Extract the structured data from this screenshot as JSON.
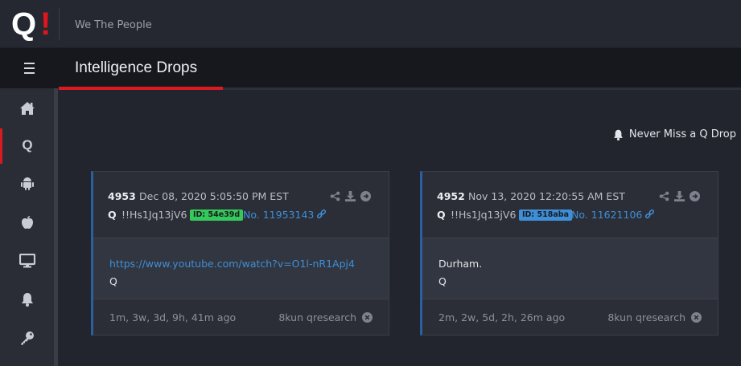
{
  "header": {
    "logo_letter": "Q",
    "logo_mark": "!",
    "tagline": "We The People"
  },
  "titlebar": {
    "menu_icon": "hamburger-icon",
    "title": "Intelligence Drops"
  },
  "sidebar": {
    "items": [
      {
        "name": "home",
        "icon": "home-icon",
        "active": false
      },
      {
        "name": "q",
        "icon": "q-icon",
        "label": "Q",
        "active": true
      },
      {
        "name": "android",
        "icon": "android-icon",
        "active": false
      },
      {
        "name": "apple",
        "icon": "apple-icon",
        "active": false
      },
      {
        "name": "desktop",
        "icon": "monitor-icon",
        "active": false
      },
      {
        "name": "notifications",
        "icon": "bell-icon",
        "active": false
      },
      {
        "name": "login",
        "icon": "key-icon",
        "active": false
      }
    ]
  },
  "notify": {
    "label": "Never Miss a Q Drop",
    "icon": "bell-icon"
  },
  "drops": [
    {
      "number": "4953",
      "date": "Dec 08, 2020 5:05:50 PM EST",
      "author": "Q",
      "tripcode": "!!Hs1Jq13jV6",
      "id_badge": "ID: 54e39d",
      "id_color": "#34c95b",
      "post_link": "No. 11953143",
      "body": [
        "https://www.youtube.com/watch?v=O1l-nR1Apj4",
        "Q"
      ],
      "ago": "1m, 3w, 3d, 9h, 41m ago",
      "source": "8kun qresearch"
    },
    {
      "number": "4952",
      "date": "Nov 13, 2020 12:20:55 AM EST",
      "author": "Q",
      "tripcode": "!!Hs1Jq13jV6",
      "id_badge": "ID: 518aba",
      "id_color": "#3e8ed8",
      "post_link": "No. 11621106",
      "body": [
        "Durham.",
        "Q"
      ],
      "ago": "2m, 2w, 5d, 2h, 26m ago",
      "source": "8kun qresearch"
    }
  ],
  "colors": {
    "accent": "#d81b21",
    "card_border_left": "#2c5fa0",
    "link": "#3f8ed6"
  }
}
